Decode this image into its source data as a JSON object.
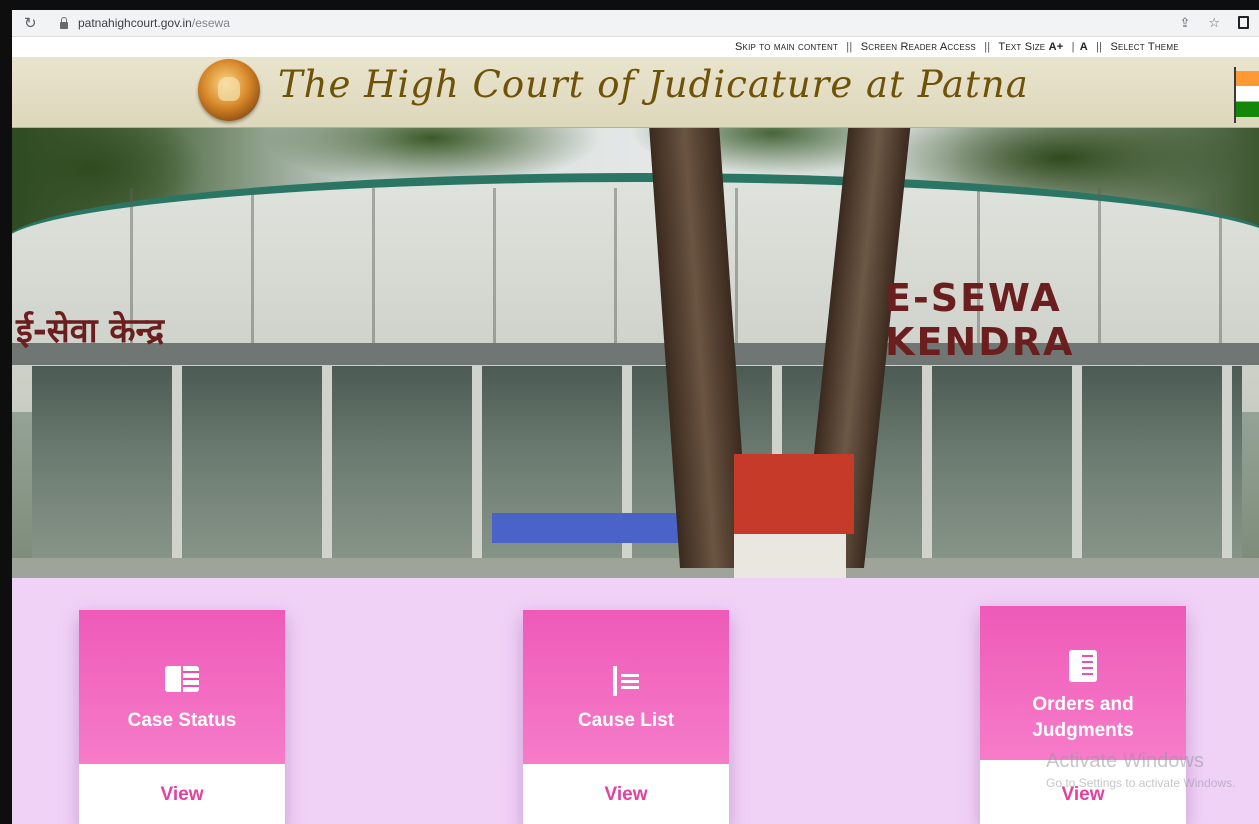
{
  "browser": {
    "url_host": "patnahighcourt.gov.in",
    "url_path": "/esewa",
    "reload_icon": "reload-icon",
    "share_icon": "share-icon",
    "star_icon": "star-icon",
    "tab_icon": "tab-icon"
  },
  "access": {
    "skip": "Skip to main content",
    "reader": "Screen Reader Access",
    "text_size": "Text Size",
    "a_plus": "A+",
    "a": "A",
    "theme": "Select Theme"
  },
  "header": {
    "title": "The High Court of Judicature at Patna"
  },
  "hero": {
    "sign_hindi": "ई-सेवा केन्द्र",
    "sign_english": "E-SEWA KENDRA"
  },
  "services": [
    {
      "label": "Case Status",
      "view": "View",
      "icon": "book-icon"
    },
    {
      "label": "Cause List",
      "view": "View",
      "icon": "list-icon"
    },
    {
      "label": "Orders and Judgments",
      "view": "View",
      "icon": "document-icon"
    }
  ],
  "watermark": {
    "title": "Activate Windows",
    "sub": "Go to Settings to activate Windows."
  },
  "colors": {
    "tile_pink": "#ee5ab8",
    "services_bg": "#f1d2f7",
    "view_text": "#e4409f",
    "header_bg": "#e9e4cd",
    "title_gold": "#6e5208"
  }
}
